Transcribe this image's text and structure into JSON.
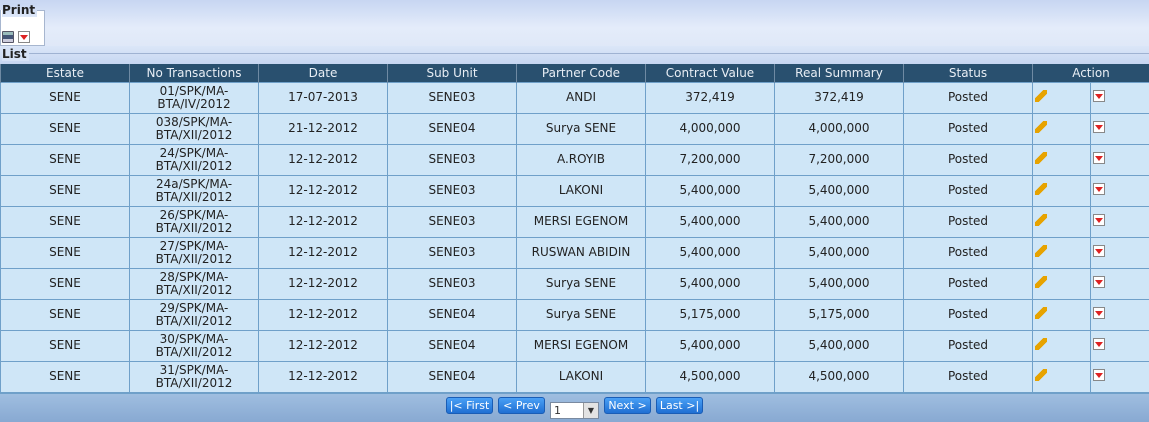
{
  "print": {
    "title": "Print",
    "icons": [
      "printer-icon",
      "pdf-icon"
    ]
  },
  "list": {
    "title": "List"
  },
  "table": {
    "headers": [
      "Estate",
      "No Transactions",
      "Date",
      "Sub Unit",
      "Partner Code",
      "Contract Value",
      "Real Summary",
      "Status",
      "Action"
    ],
    "rows": [
      {
        "estate": "SENE",
        "no_line1": "01/SPK/MA-",
        "no_line2": "BTA/IV/2012",
        "date": "17-07-2013",
        "sub_unit": "SENE03",
        "partner": "ANDI",
        "contract": "372,419",
        "real": "372,419",
        "status": "Posted"
      },
      {
        "estate": "SENE",
        "no_line1": "038/SPK/MA-",
        "no_line2": "BTA/XII/2012",
        "date": "21-12-2012",
        "sub_unit": "SENE04",
        "partner": "Surya SENE",
        "contract": "4,000,000",
        "real": "4,000,000",
        "status": "Posted"
      },
      {
        "estate": "SENE",
        "no_line1": "24/SPK/MA-",
        "no_line2": "BTA/XII/2012",
        "date": "12-12-2012",
        "sub_unit": "SENE03",
        "partner": "A.ROYIB",
        "contract": "7,200,000",
        "real": "7,200,000",
        "status": "Posted"
      },
      {
        "estate": "SENE",
        "no_line1": "24a/SPK/MA-",
        "no_line2": "BTA/XII/2012",
        "date": "12-12-2012",
        "sub_unit": "SENE03",
        "partner": "LAKONI",
        "contract": "5,400,000",
        "real": "5,400,000",
        "status": "Posted"
      },
      {
        "estate": "SENE",
        "no_line1": "26/SPK/MA-",
        "no_line2": "BTA/XII/2012",
        "date": "12-12-2012",
        "sub_unit": "SENE03",
        "partner": "MERSI EGENOM",
        "contract": "5,400,000",
        "real": "5,400,000",
        "status": "Posted"
      },
      {
        "estate": "SENE",
        "no_line1": "27/SPK/MA-",
        "no_line2": "BTA/XII/2012",
        "date": "12-12-2012",
        "sub_unit": "SENE03",
        "partner": "RUSWAN ABIDIN",
        "contract": "5,400,000",
        "real": "5,400,000",
        "status": "Posted"
      },
      {
        "estate": "SENE",
        "no_line1": "28/SPK/MA-",
        "no_line2": "BTA/XII/2012",
        "date": "12-12-2012",
        "sub_unit": "SENE03",
        "partner": "Surya SENE",
        "contract": "5,400,000",
        "real": "5,400,000",
        "status": "Posted"
      },
      {
        "estate": "SENE",
        "no_line1": "29/SPK/MA-",
        "no_line2": "BTA/XII/2012",
        "date": "12-12-2012",
        "sub_unit": "SENE04",
        "partner": "Surya SENE",
        "contract": "5,175,000",
        "real": "5,175,000",
        "status": "Posted"
      },
      {
        "estate": "SENE",
        "no_line1": "30/SPK/MA-",
        "no_line2": "BTA/XII/2012",
        "date": "12-12-2012",
        "sub_unit": "SENE04",
        "partner": "MERSI EGENOM",
        "contract": "5,400,000",
        "real": "5,400,000",
        "status": "Posted"
      },
      {
        "estate": "SENE",
        "no_line1": "31/SPK/MA-",
        "no_line2": "BTA/XII/2012",
        "date": "12-12-2012",
        "sub_unit": "SENE04",
        "partner": "LAKONI",
        "contract": "4,500,000",
        "real": "4,500,000",
        "status": "Posted"
      }
    ],
    "action_icons": [
      "edit-pencil-icon",
      "pdf-icon"
    ]
  },
  "pagination": {
    "first_label": "First",
    "prev_label": "Prev",
    "page_value": "1",
    "next_label": "Next",
    "last_label": "Last"
  },
  "colors": {
    "header_bg": "#29506f",
    "row_bg": "#cfe6f7",
    "button_bg": "#2a7ee0"
  }
}
